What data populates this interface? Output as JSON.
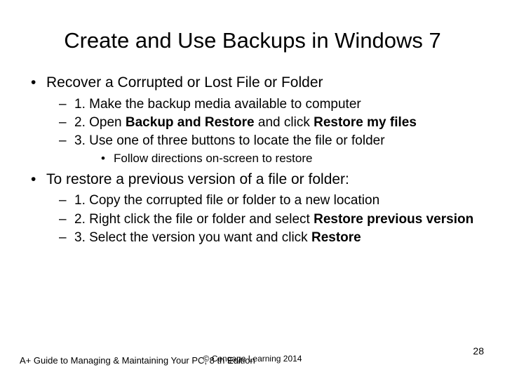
{
  "title": "Create and Use Backups in Windows 7",
  "bullets": {
    "b1": "Recover a Corrupted or Lost File or Folder",
    "b1_1": "1. Make the backup media available to computer",
    "b1_2a": "2. Open ",
    "b1_2b": "Backup and Restore",
    "b1_2c": " and click ",
    "b1_2d": "Restore my files",
    "b1_3": "3. Use one of three buttons to locate the file or folder",
    "b1_3_1": "Follow directions on-screen to restore",
    "b2": "To restore a previous version of a file or folder:",
    "b2_1": "1. Copy the corrupted file or folder to a new location",
    "b2_2a": "2. Right click the file or folder and select ",
    "b2_2b": "Restore previous version",
    "b2_3a": "3. Select the version you want and click ",
    "b2_3b": "Restore"
  },
  "footer": {
    "left": "A+ Guide to Managing & Maintaining Your PC, 8 th Edition",
    "center": "© Cengage Learning  2014",
    "right": "28"
  }
}
